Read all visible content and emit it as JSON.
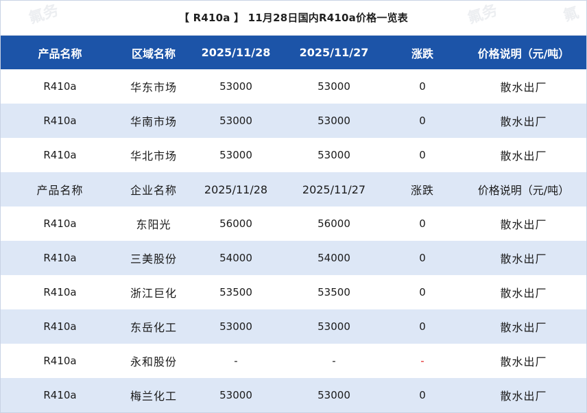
{
  "title": "【 R410a 】 11月28日国内R410a价格一览表",
  "header": [
    "产品名称",
    "区域名称",
    "2025/11/28",
    "2025/11/27",
    "涨跌",
    "价格说明（元/吨）"
  ],
  "region_rows": [
    [
      "R410a",
      "华东市场",
      "53000",
      "53000",
      "0",
      "散水出厂"
    ],
    [
      "R410a",
      "华南市场",
      "53000",
      "53000",
      "0",
      "散水出厂"
    ],
    [
      "R410a",
      "华北市场",
      "53000",
      "53000",
      "0",
      "散水出厂"
    ]
  ],
  "subheader": [
    "产品名称",
    "企业名称",
    "2025/11/28",
    "2025/11/27",
    "涨跌",
    "价格说明（元/吨）"
  ],
  "company_rows": [
    [
      "R410a",
      "东阳光",
      "56000",
      "56000",
      "0",
      "散水出厂"
    ],
    [
      "R410a",
      "三美股份",
      "54000",
      "54000",
      "0",
      "散水出厂"
    ],
    [
      "R410a",
      "浙江巨化",
      "53500",
      "53500",
      "0",
      "散水出厂"
    ],
    [
      "R410a",
      "东岳化工",
      "53000",
      "53000",
      "0",
      "散水出厂"
    ],
    [
      "R410a",
      "永和股份",
      "-",
      "-",
      "-",
      "散水出厂"
    ],
    [
      "R410a",
      "梅兰化工",
      "53000",
      "53000",
      "0",
      "散水出厂"
    ]
  ],
  "colors": {
    "header_bg": "#1c54a8",
    "stripe_bg": "#dde7f6",
    "negative": "#e02020"
  }
}
